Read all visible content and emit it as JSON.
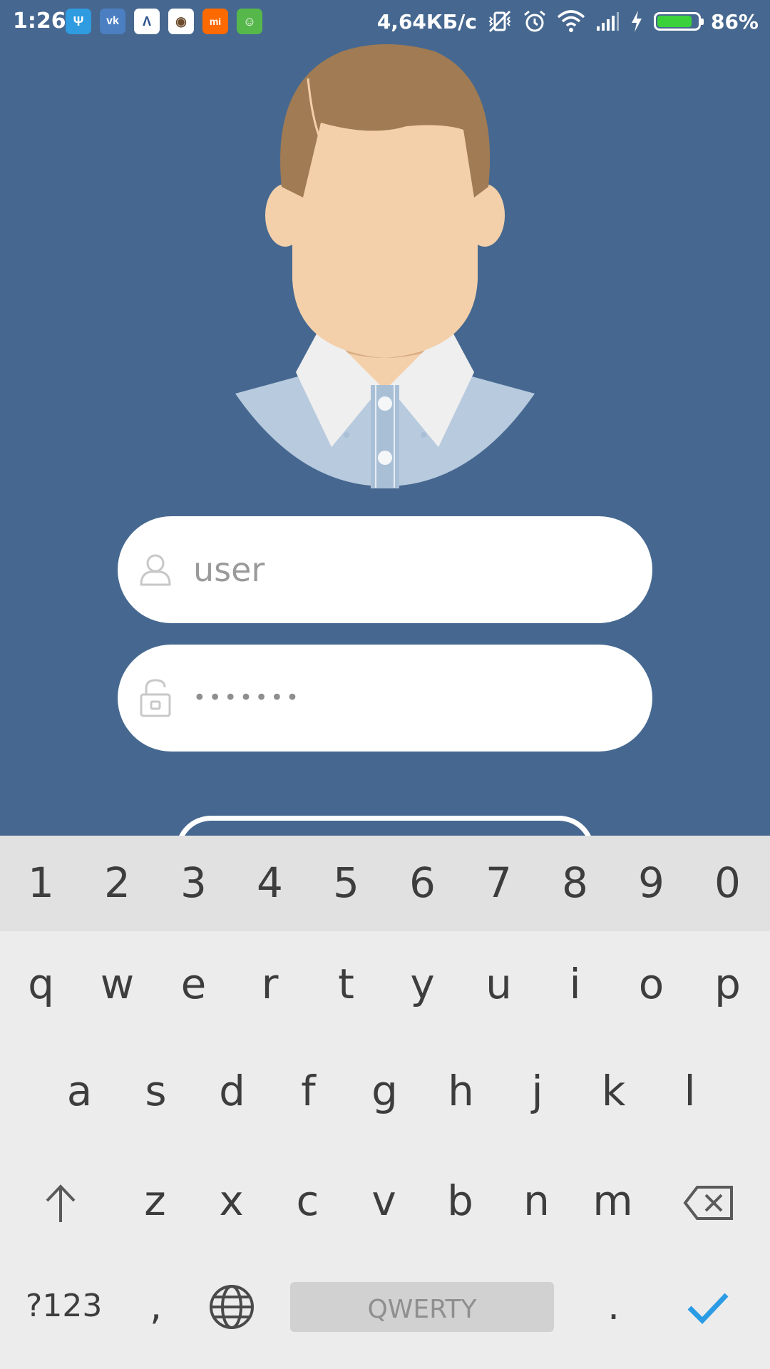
{
  "status_bar": {
    "time": "1:26",
    "network_speed": "4,64КБ/с",
    "battery_percent": "86%",
    "battery_level": 0.86,
    "app_icons": [
      {
        "name": "usb-icon",
        "color": "#2f9be0"
      },
      {
        "name": "vk-icon",
        "color": "#4b7fc2"
      },
      {
        "name": "arrow-up-app-icon",
        "color": "#ffffff"
      },
      {
        "name": "cat-app-icon",
        "color": "#ffffff"
      },
      {
        "name": "mi-icon",
        "color": "#ff6a00"
      },
      {
        "name": "android-icon",
        "color": "#56b74a"
      }
    ]
  },
  "login": {
    "username_placeholder": "user",
    "password_value": "•••••••"
  },
  "keyboard": {
    "number_row": [
      "1",
      "2",
      "3",
      "4",
      "5",
      "6",
      "7",
      "8",
      "9",
      "0"
    ],
    "row1": [
      "q",
      "w",
      "e",
      "r",
      "t",
      "y",
      "u",
      "i",
      "o",
      "p"
    ],
    "row2": [
      "a",
      "s",
      "d",
      "f",
      "g",
      "h",
      "j",
      "k",
      "l"
    ],
    "row3": [
      "z",
      "x",
      "c",
      "v",
      "b",
      "n",
      "m"
    ],
    "symbols_label": "?123",
    "comma": ",",
    "space_label": "QWERTY",
    "period": ".",
    "enter_color": "#2a9be4"
  },
  "colors": {
    "background": "#466890",
    "skin": "#f3d0aa",
    "hair": "#a07b53",
    "shirt": "#b8cade"
  }
}
